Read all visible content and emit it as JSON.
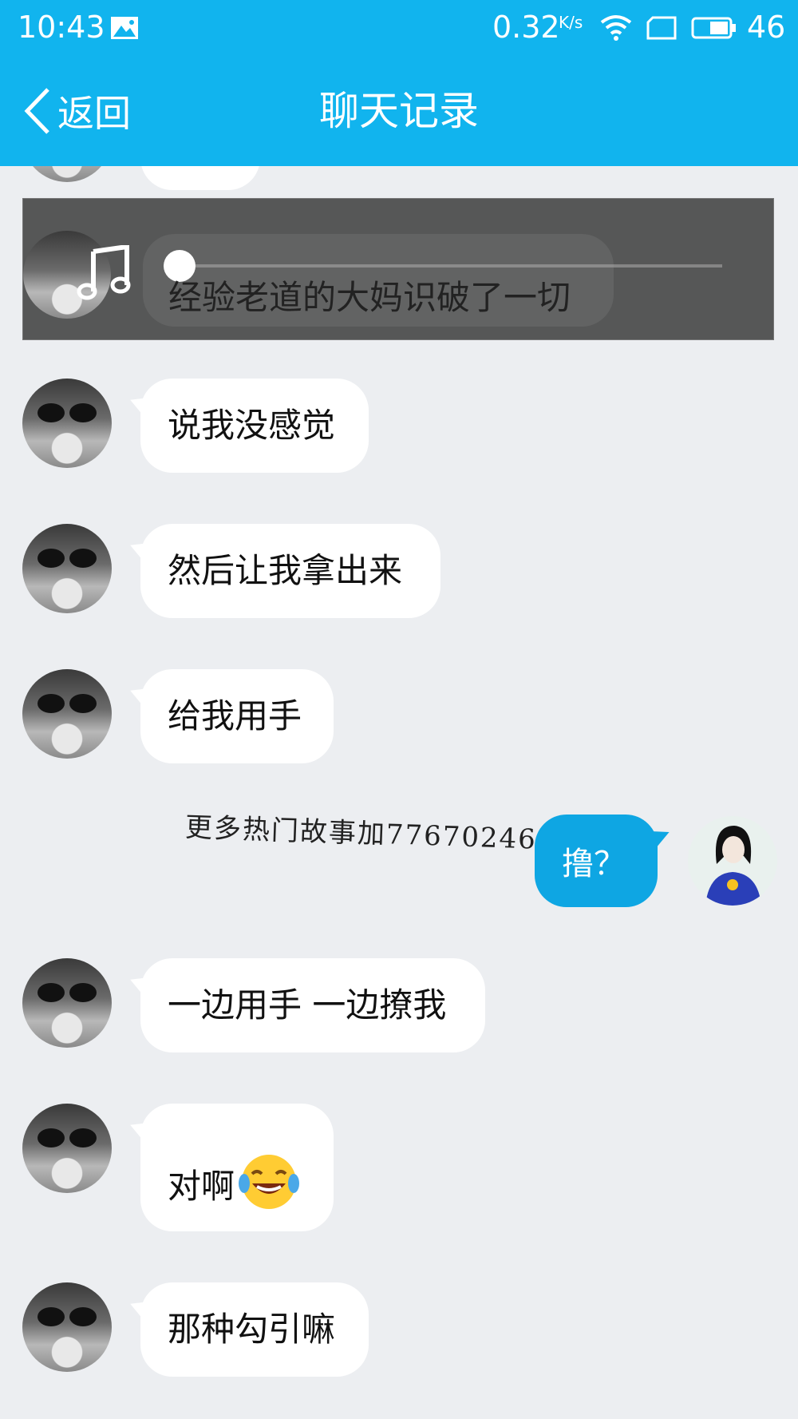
{
  "status_bar": {
    "time": "10:43",
    "net_speed": "0.32",
    "net_speed_unit": "K/s",
    "battery_level": "46",
    "icons": [
      "image-icon",
      "wifi-icon",
      "screen-icon",
      "battery-icon"
    ]
  },
  "nav": {
    "back_label": "返回",
    "title": "聊天记录"
  },
  "player": {
    "caption": "经验老道的大妈识破了一切",
    "icon": "music-note-icon"
  },
  "messages": [
    {
      "side": "left",
      "text": "说我没感觉"
    },
    {
      "side": "left",
      "text": "然后让我拿出来"
    },
    {
      "side": "left",
      "text": "给我用手"
    },
    {
      "side": "right",
      "text": "撸？"
    },
    {
      "side": "left",
      "text": "一边用手 一边撩我"
    },
    {
      "side": "left",
      "text": "对啊",
      "emoji": "tears-of-joy-emoji"
    },
    {
      "side": "left",
      "text": "那种勾引嘛"
    }
  ],
  "watermark": "更多热门故事加77670246",
  "colors": {
    "header": "#11b4ee",
    "background": "#eceef1",
    "bubble_in": "#ffffff",
    "bubble_out": "#0ea6e3"
  }
}
